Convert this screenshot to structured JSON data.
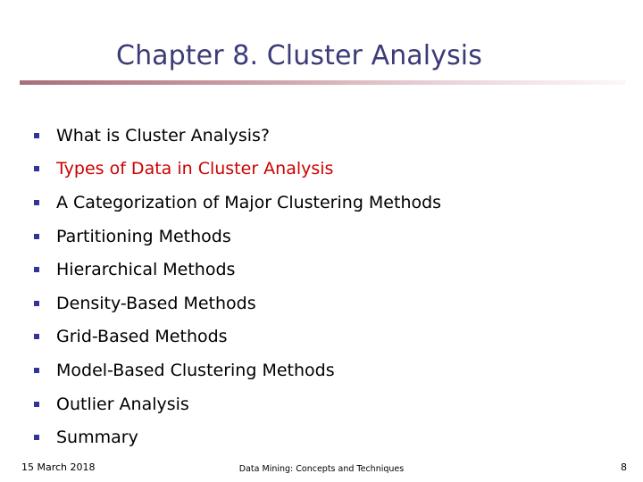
{
  "slide": {
    "title": "Chapter 8. Cluster Analysis",
    "title_color": "#3b3b78",
    "background_color": "#ffffff",
    "rule_gradient_start": "#a96f79",
    "rule_gradient_end": "#fbf6f9",
    "bullet_marker_color": "#333399",
    "accent_color": "#cc0000"
  },
  "outline": {
    "items": [
      {
        "label": "What is Cluster Analysis?",
        "highlighted": false
      },
      {
        "label": "Types of Data in Cluster Analysis",
        "highlighted": true
      },
      {
        "label": "A Categorization of Major Clustering Methods",
        "highlighted": false
      },
      {
        "label": "Partitioning Methods",
        "highlighted": false
      },
      {
        "label": "Hierarchical Methods",
        "highlighted": false
      },
      {
        "label": "Density-Based Methods",
        "highlighted": false
      },
      {
        "label": "Grid-Based Methods",
        "highlighted": false
      },
      {
        "label": "Model-Based Clustering Methods",
        "highlighted": false
      },
      {
        "label": "Outlier Analysis",
        "highlighted": false
      },
      {
        "label": "Summary",
        "highlighted": false
      }
    ]
  },
  "footer": {
    "date": "15 March 2018",
    "center": "Data Mining: Concepts and Techniques",
    "page_number": "8"
  }
}
